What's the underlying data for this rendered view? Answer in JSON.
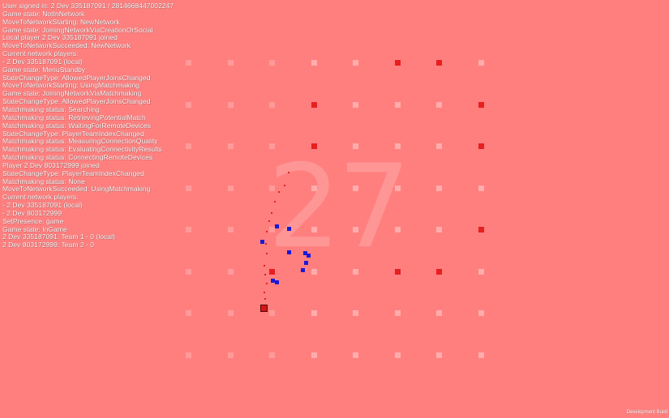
{
  "log": [
    "User signed in: 2 Dev 335187091 / 2814668447002247",
    "Game state: NotInNetwork",
    "MoveToNetworkStarting: NewNetwork",
    "Game state: JoiningNetworkViaCreationOrSocial",
    "Local player 2 Dev 335187091 joined",
    "MoveToNetworkSucceeded: NewNetwork",
    "Current network players:",
    " - 2 Dev 335187091 (local)",
    "Game state: MenuStandby",
    "StateChangeType: AllowedPlayerJoinsChanged",
    "MoveToNetworkStarting: UsingMatchmaking",
    "Game state: JoiningNetworkViaMatchmaking",
    "StateChangeType: AllowedPlayerJoinsChanged",
    "Matchmaking status: Searching",
    "Matchmaking status: RetrievingPotentialMatch",
    "Matchmaking status: WaitingForRemoteDevices",
    "StateChangeType: PlayerTeamIndexChanged",
    "Matchmaking status: MeasuringConnectionQuality",
    "Matchmaking status: EvaluatingConnectivityResults",
    "Matchmaking status: ConnectingRemoteDevices",
    "Player 2 Dev 803172999 joined",
    "StateChangeType: PlayerTeamIndexChanged",
    "Matchmaking status: None",
    "MoveToNetworkSucceeded: UsingMatchmaking",
    "Current network players:",
    " - 2 Dev 335187091 (local)",
    " - 2 Dev 803172999",
    "SetPresence: game",
    "Game state: InGame",
    "2 Dev 335187091: Team 1 - 0 (local)",
    "2 Dev 803172999: Team 2 - 0"
  ],
  "score": "27",
  "footer": "Development Build",
  "colors": {
    "background": "#ff7f7f",
    "cell_faint": "#ff9a9a",
    "cell_light": "#ffacac",
    "cell_active": "#e81f1f",
    "player": "#d01818",
    "opponent": "#1a1ad6"
  },
  "grid": {
    "rows": 8,
    "cols": 8,
    "active_cells": [
      [
        0,
        5
      ],
      [
        0,
        6
      ],
      [
        1,
        3
      ],
      [
        1,
        7
      ],
      [
        2,
        3
      ],
      [
        2,
        7
      ],
      [
        4,
        7
      ],
      [
        5,
        2
      ],
      [
        5,
        5
      ],
      [
        5,
        6
      ]
    ]
  }
}
